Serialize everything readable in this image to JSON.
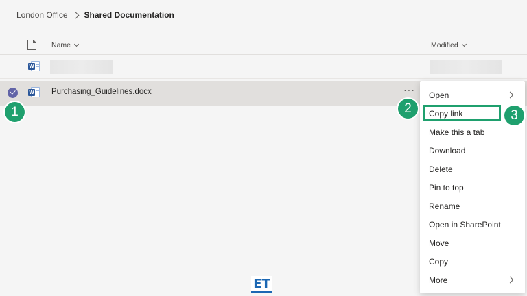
{
  "breadcrumb": {
    "root": "London Office",
    "current": "Shared Documentation"
  },
  "columns": {
    "name": "Name",
    "modified": "Modified"
  },
  "files": [
    {
      "name": "",
      "modified": "",
      "type": "word",
      "redacted": true
    },
    {
      "name": "Purchasing_Guidelines.docx",
      "modified": "",
      "type": "word",
      "selected": true
    }
  ],
  "more_label": "···",
  "context_menu": {
    "items": [
      {
        "label": "Open",
        "submenu": true
      },
      {
        "label": "Copy link",
        "highlighted": true
      },
      {
        "label": "Make this a tab"
      },
      {
        "label": "Download"
      },
      {
        "label": "Delete"
      },
      {
        "label": "Pin to top"
      },
      {
        "label": "Rename"
      },
      {
        "label": "Open in SharePoint"
      },
      {
        "label": "Move"
      },
      {
        "label": "Copy"
      },
      {
        "label": "More",
        "submenu": true
      }
    ]
  },
  "callouts": [
    "1",
    "2",
    "3"
  ],
  "watermark": "ET",
  "colors": {
    "accent": "#6264a7",
    "callout": "#1fa06e",
    "word": "#2b579a",
    "selected_row": "#e1dfdd"
  }
}
